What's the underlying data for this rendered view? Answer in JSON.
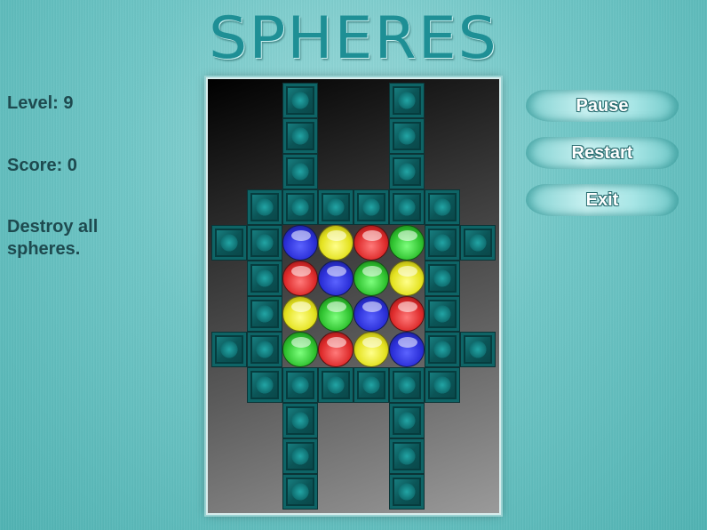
{
  "title": "SPHERES",
  "info": {
    "level": "Level: 9",
    "score": "Score: 0",
    "goal": "Destroy all spheres."
  },
  "buttons": {
    "pause": "Pause",
    "restart": "Restart",
    "exit": "Exit"
  },
  "board": {
    "cols": 8,
    "rows": 12,
    "tiles": [
      [
        2,
        0
      ],
      [
        5,
        0
      ],
      [
        2,
        1
      ],
      [
        5,
        1
      ],
      [
        2,
        2
      ],
      [
        5,
        2
      ],
      [
        1,
        3
      ],
      [
        2,
        3
      ],
      [
        3,
        3
      ],
      [
        4,
        3
      ],
      [
        5,
        3
      ],
      [
        6,
        3
      ],
      [
        0,
        4
      ],
      [
        1,
        4
      ],
      [
        6,
        4
      ],
      [
        7,
        4
      ],
      [
        1,
        5
      ],
      [
        6,
        5
      ],
      [
        1,
        6
      ],
      [
        6,
        6
      ],
      [
        0,
        7
      ],
      [
        1,
        7
      ],
      [
        6,
        7
      ],
      [
        7,
        7
      ],
      [
        1,
        8
      ],
      [
        2,
        8
      ],
      [
        3,
        8
      ],
      [
        4,
        8
      ],
      [
        5,
        8
      ],
      [
        6,
        8
      ],
      [
        2,
        9
      ],
      [
        5,
        9
      ],
      [
        2,
        10
      ],
      [
        5,
        10
      ],
      [
        2,
        11
      ],
      [
        5,
        11
      ]
    ],
    "spheres": [
      {
        "col": 2,
        "row": 4,
        "color": "blue"
      },
      {
        "col": 3,
        "row": 4,
        "color": "yellow"
      },
      {
        "col": 4,
        "row": 4,
        "color": "red"
      },
      {
        "col": 5,
        "row": 4,
        "color": "green"
      },
      {
        "col": 2,
        "row": 5,
        "color": "red"
      },
      {
        "col": 3,
        "row": 5,
        "color": "blue"
      },
      {
        "col": 4,
        "row": 5,
        "color": "green"
      },
      {
        "col": 5,
        "row": 5,
        "color": "yellow"
      },
      {
        "col": 2,
        "row": 6,
        "color": "yellow"
      },
      {
        "col": 3,
        "row": 6,
        "color": "green"
      },
      {
        "col": 4,
        "row": 6,
        "color": "blue"
      },
      {
        "col": 5,
        "row": 6,
        "color": "red"
      },
      {
        "col": 2,
        "row": 7,
        "color": "green"
      },
      {
        "col": 3,
        "row": 7,
        "color": "red"
      },
      {
        "col": 4,
        "row": 7,
        "color": "yellow"
      },
      {
        "col": 5,
        "row": 7,
        "color": "blue"
      }
    ]
  }
}
